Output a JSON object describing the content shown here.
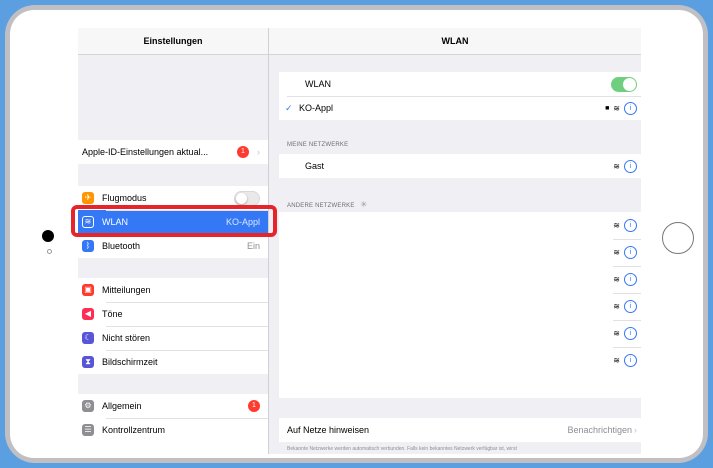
{
  "sidebar": {
    "title": "Einstellungen",
    "apple_id": {
      "label": "Apple-ID-Einstellungen aktual...",
      "badge": "1"
    },
    "group1": [
      {
        "label": "Flugmodus",
        "value": "",
        "icon": "airplane-icon",
        "color": "#ff9500"
      },
      {
        "label": "WLAN",
        "value": "KO-Appl",
        "icon": "wifi-icon",
        "color": "#3478f6"
      },
      {
        "label": "Bluetooth",
        "value": "Ein",
        "icon": "bluetooth-icon",
        "color": "#3478f6"
      }
    ],
    "group2": [
      {
        "label": "Mitteilungen",
        "icon": "notifications-icon",
        "color": "#ff3b30"
      },
      {
        "label": "Töne",
        "icon": "sounds-icon",
        "color": "#ff2d55"
      },
      {
        "label": "Nicht stören",
        "icon": "moon-icon",
        "color": "#5856d6"
      },
      {
        "label": "Bildschirmzeit",
        "icon": "hourglass-icon",
        "color": "#5856d6"
      }
    ],
    "group3": [
      {
        "label": "Allgemein",
        "icon": "gear-icon",
        "color": "#8e8e93",
        "badge": "1"
      },
      {
        "label": "Kontrollzentrum",
        "icon": "control-center-icon",
        "color": "#8e8e93"
      }
    ]
  },
  "detail": {
    "title": "WLAN",
    "wlan_label": "WLAN",
    "connected_network": "KO-Appl",
    "my_networks_title": "MEINE NETZWERKE",
    "my_networks": [
      "Gast"
    ],
    "other_networks_title": "ANDERE NETZWERKE",
    "other_networks_count_rows": 6,
    "ask_label": "Auf Netze hinweisen",
    "ask_value": "Benachrichtigen",
    "footer_text": "Bekannte Netzwerke werden automatisch verbunden. Falls kein bekanntes Netzwerk verfügbar ist, wirst"
  },
  "icons": {
    "info": "ⓘ",
    "chevron": "›",
    "check": "✓",
    "lock": "🔒"
  },
  "colors": {
    "accent": "#3478f6",
    "toggle_on": "#6fcf7f",
    "highlight": "#e5252a",
    "background": "#5b9fe0"
  }
}
